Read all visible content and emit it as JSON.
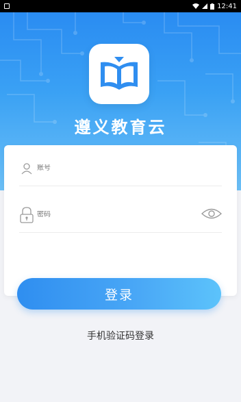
{
  "status_bar": {
    "time": "12:41",
    "icons": [
      "app-notification-icon",
      "wifi-icon",
      "signal-icon",
      "battery-icon"
    ]
  },
  "app": {
    "name": "遵义教育云",
    "logo_icon": "open-book-icon"
  },
  "login_form": {
    "account_placeholder": "账号",
    "password_placeholder": "密码",
    "account_icon": "user-icon",
    "password_icon": "lock-icon",
    "password_visibility_icon": "eye-icon",
    "submit_label": "登录",
    "alt_login_label": "手机验证码登录"
  },
  "colors": {
    "primary": "#2f8ef0",
    "gradient_end": "#5cc3fb",
    "background": "#f2f3f7"
  }
}
